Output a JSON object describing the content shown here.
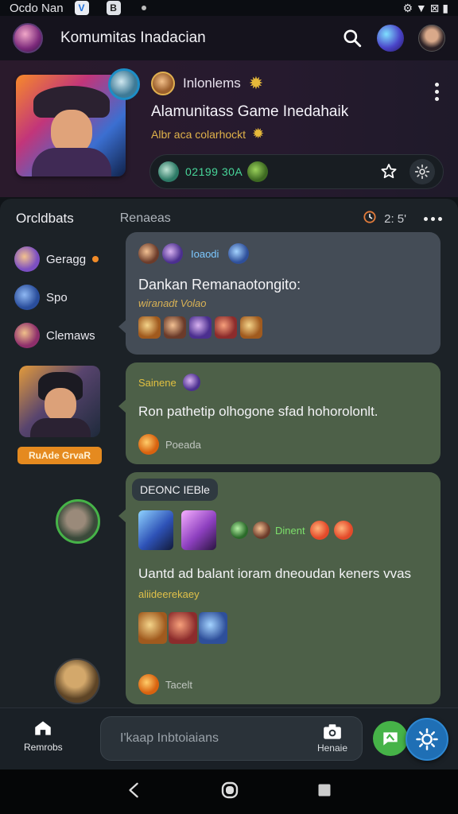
{
  "status_bar": {
    "time": "Ocdo Nan",
    "app_icon_1": "V",
    "app_icon_2": "B",
    "signal_text": "⚙ ▼ ⊠ ▮"
  },
  "app_bar": {
    "title": "Komumitas Inadacian",
    "icons": [
      "search-icon",
      "avatar",
      "avatar"
    ]
  },
  "group": {
    "moderator_label": "Inlonlems",
    "name": "Alamunitass Game Inedahaik",
    "subtitle": "Albr aca colarhockt",
    "member_count": "02199 30A"
  },
  "panel": {
    "tab_active": "Orcldbats",
    "tab_inactive": "Renaeas",
    "timer": "2: 5'"
  },
  "sidebar": {
    "items": [
      {
        "label": "Geragg"
      },
      {
        "label": "Spo"
      },
      {
        "label": "Clemaws"
      }
    ]
  },
  "messages": [
    {
      "author": "Ioaodi",
      "text": "Dankan Remanaotongito:",
      "subtext": "wiranadt Volao"
    },
    {
      "author": "Sainene",
      "text": "Ron pathetip olhogone sfad hohorolonlt.",
      "reply_label": "Poeada",
      "poster_tag": "RuAde GrvaR"
    },
    {
      "tag": "DEONC IEBle",
      "author": "Dinent",
      "text": "Uantd ad balant ioram dneoudan keners vvas",
      "subtext": "aliideerekaey",
      "reply_label": "Tacelt"
    }
  ],
  "bottom_bar": {
    "home_label": "Remrobs",
    "composer_placeholder": "I'kaap Inbtoiaians",
    "camera_label": "Henaie"
  },
  "colors": {
    "accent_green": "#46b348",
    "accent_blue": "#1f6fb5",
    "accent_orange": "#e58a1f",
    "bubble_gray": "#444c56",
    "bubble_green": "#4d6048"
  }
}
